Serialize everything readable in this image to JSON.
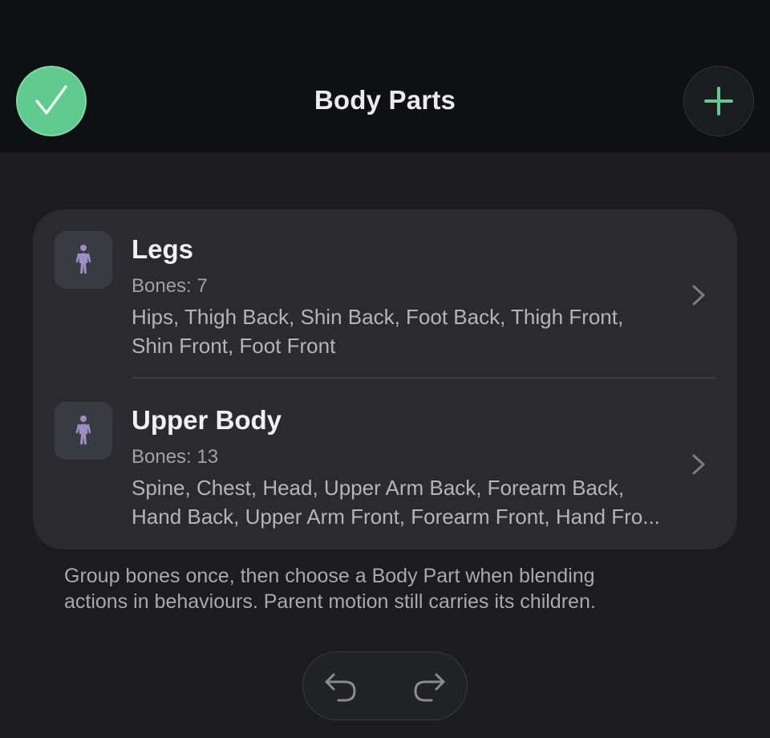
{
  "header": {
    "title": "Body Parts",
    "done_icon": "checkmark-icon",
    "add_icon": "plus-icon"
  },
  "colors": {
    "accent_green": "#5fc98e",
    "icon_purple": "#9d8fbf",
    "background": "#1c1c1f",
    "card": "#2b2b2f"
  },
  "body_parts": [
    {
      "name": "Legs",
      "count": "Bones: 7",
      "bones_line1": "Hips, Thigh Back, Shin Back, Foot Back, Thigh Front,",
      "bones_line2": "Shin Front, Foot Front",
      "icon": "person-icon"
    },
    {
      "name": "Upper Body",
      "count": "Bones: 13",
      "bones_line1": "Spine, Chest, Head, Upper Arm Back, Forearm Back,",
      "bones_line2": "Hand Back, Upper Arm Front, Forearm Front, Hand Fro...",
      "icon": "person-icon"
    }
  ],
  "footnote": {
    "line1": "Group bones once, then choose a Body Part when blending",
    "line2": "actions in behaviours. Parent motion still carries its children."
  },
  "history": {
    "undo_icon": "undo-icon",
    "redo_icon": "redo-icon"
  }
}
